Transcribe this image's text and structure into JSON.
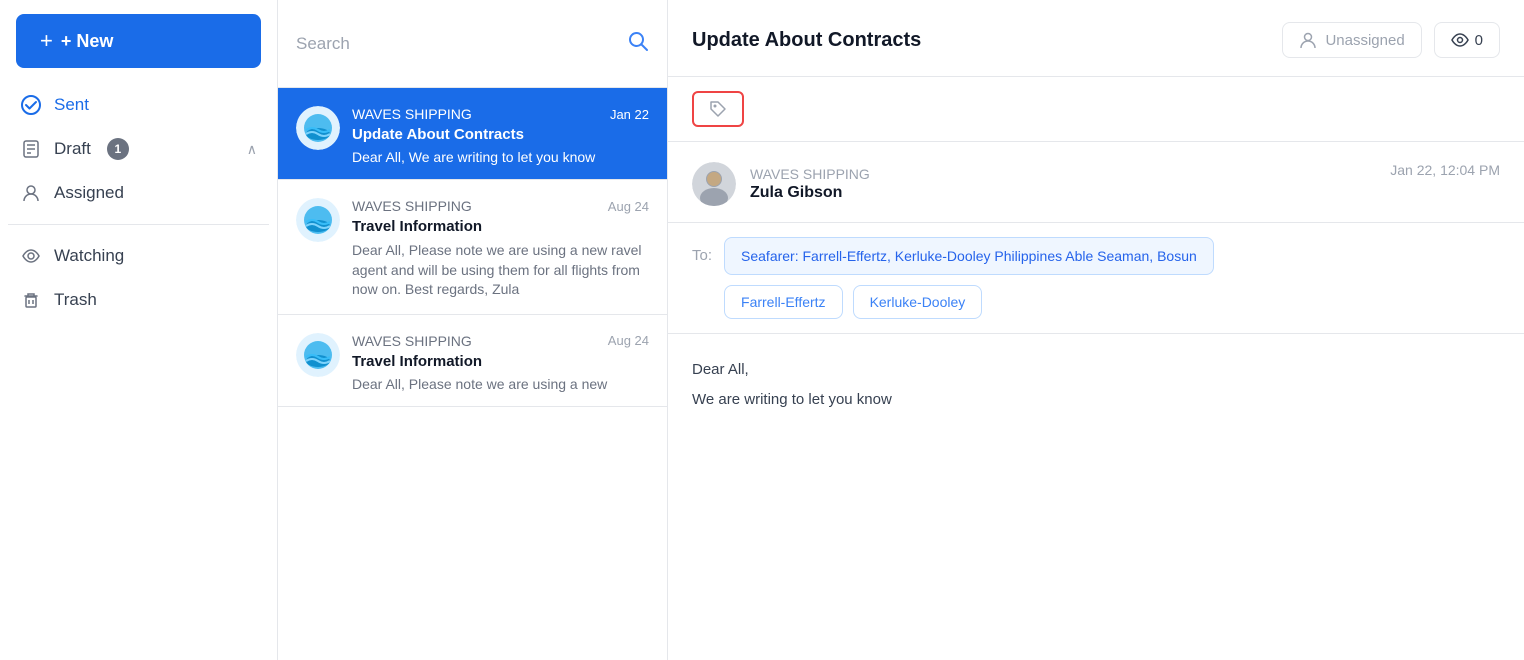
{
  "sidebar": {
    "new_button": "+ New",
    "items": [
      {
        "id": "sent",
        "label": "Sent",
        "icon": "✓",
        "active": true,
        "badge": null
      },
      {
        "id": "draft",
        "label": "Draft",
        "icon": "📄",
        "active": false,
        "badge": "1",
        "has_chevron": true
      },
      {
        "id": "assigned",
        "label": "Assigned",
        "icon": "👤",
        "active": false,
        "badge": null
      },
      {
        "id": "watching",
        "label": "Watching",
        "icon": "👁",
        "active": false,
        "badge": null
      },
      {
        "id": "trash",
        "label": "Trash",
        "icon": "🗑",
        "active": false,
        "badge": null
      }
    ]
  },
  "search": {
    "placeholder": "Search"
  },
  "email_list": {
    "items": [
      {
        "id": "1",
        "sender": "WAVES SHIPPING",
        "date": "Jan 22",
        "subject": "Update About Contracts",
        "preview": "Dear All, We are writing to let you know",
        "selected": true
      },
      {
        "id": "2",
        "sender": "WAVES SHIPPING",
        "date": "Aug 24",
        "subject": "Travel Information",
        "preview": "Dear All, Please note we are using a new ravel agent and will be using them for all flights from now on. Best regards, Zula",
        "selected": false
      },
      {
        "id": "3",
        "sender": "WAVES SHIPPING",
        "date": "Aug 24",
        "subject": "Travel Information",
        "preview": "Dear All, Please note we are using a new",
        "selected": false
      }
    ]
  },
  "email_detail": {
    "title": "Update About Contracts",
    "assign_label": "Unassigned",
    "views_label": "0",
    "tag_icon": "🏷",
    "message": {
      "company": "WAVES SHIPPING",
      "name": "Zula Gibson",
      "date": "Jan 22, 12:04 PM",
      "to_label": "To:",
      "to_main": "Seafarer: Farrell-Effertz, Kerluke-Dooley Philippines Able Seaman, Bosun",
      "to_tags": [
        "Farrell-Effertz",
        "Kerluke-Dooley"
      ],
      "body_line1": "Dear All,",
      "body_line2": "We are writing to let you know"
    }
  }
}
